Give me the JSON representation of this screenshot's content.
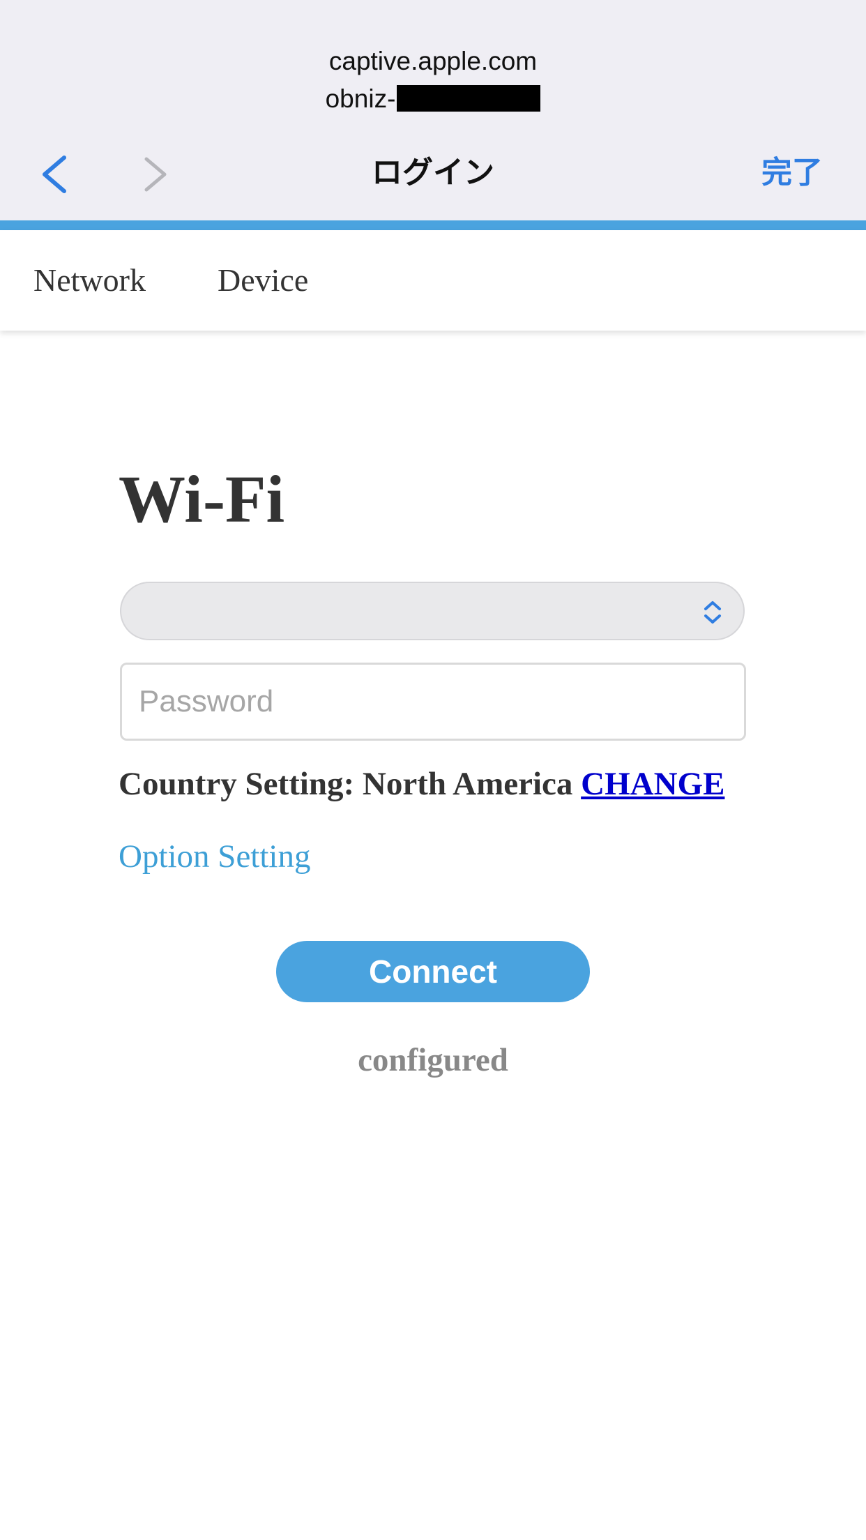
{
  "sheet": {
    "domain": "captive.apple.com",
    "network_prefix": "obniz-",
    "title": "ログイン",
    "done_label": "完了"
  },
  "nav": {
    "back_icon": "chevron-left-icon",
    "forward_icon": "chevron-right-icon"
  },
  "tabs": [
    {
      "label": "Network"
    },
    {
      "label": "Device"
    }
  ],
  "main": {
    "heading": "Wi-Fi",
    "ssid_select_value": "",
    "password_placeholder": "Password",
    "password_value": "",
    "country_label": "Country Setting: North America",
    "change_link": "CHANGE",
    "option_setting_link": "Option Setting",
    "connect_label": "Connect",
    "status_text": "configured"
  },
  "colors": {
    "accent": "#4aa3df",
    "ios_blue": "#2f7de1",
    "link_blue": "#0000cc",
    "option_link": "#3d9fd6",
    "sheet_bg": "#efeef4",
    "text_dark": "#333333",
    "status_gray": "#888888"
  }
}
